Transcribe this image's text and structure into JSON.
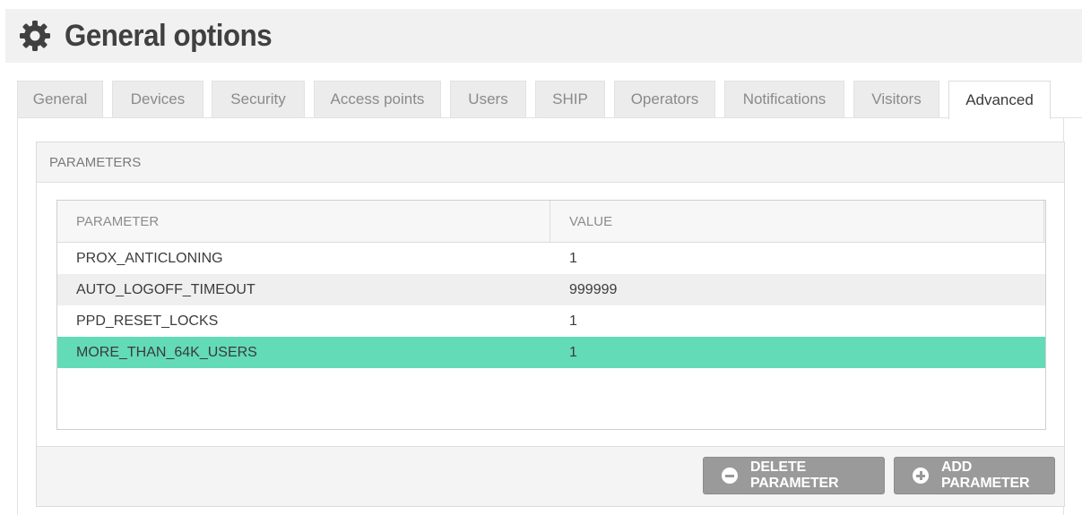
{
  "header": {
    "title": "General options",
    "icon": "gear-icon"
  },
  "tabs": [
    {
      "label": "General",
      "active": false
    },
    {
      "label": "Devices",
      "active": false
    },
    {
      "label": "Security",
      "active": false
    },
    {
      "label": "Access points",
      "active": false
    },
    {
      "label": "Users",
      "active": false
    },
    {
      "label": "SHIP",
      "active": false
    },
    {
      "label": "Operators",
      "active": false
    },
    {
      "label": "Notifications",
      "active": false
    },
    {
      "label": "Visitors",
      "active": false
    },
    {
      "label": "Advanced",
      "active": true
    }
  ],
  "panel": {
    "title": "PARAMETERS",
    "table": {
      "columns": [
        "PARAMETER",
        "VALUE"
      ],
      "rows": [
        {
          "parameter": "PROX_ANTICLONING",
          "value": "1"
        },
        {
          "parameter": "AUTO_LOGOFF_TIMEOUT",
          "value": "999999"
        },
        {
          "parameter": "PPD_RESET_LOCKS",
          "value": "1"
        },
        {
          "parameter": "MORE_THAN_64K_USERS",
          "value": "1",
          "selected": true
        }
      ]
    },
    "buttons": {
      "delete_label": "DELETE PARAMETER",
      "delete_icon": "minus-circle-icon",
      "add_label": "ADD PARAMETER",
      "add_icon": "plus-circle-icon"
    }
  },
  "colors": {
    "selected_row": "#62dbb6",
    "button": "#9a9a9a",
    "header_bg": "#f1f1f1"
  }
}
